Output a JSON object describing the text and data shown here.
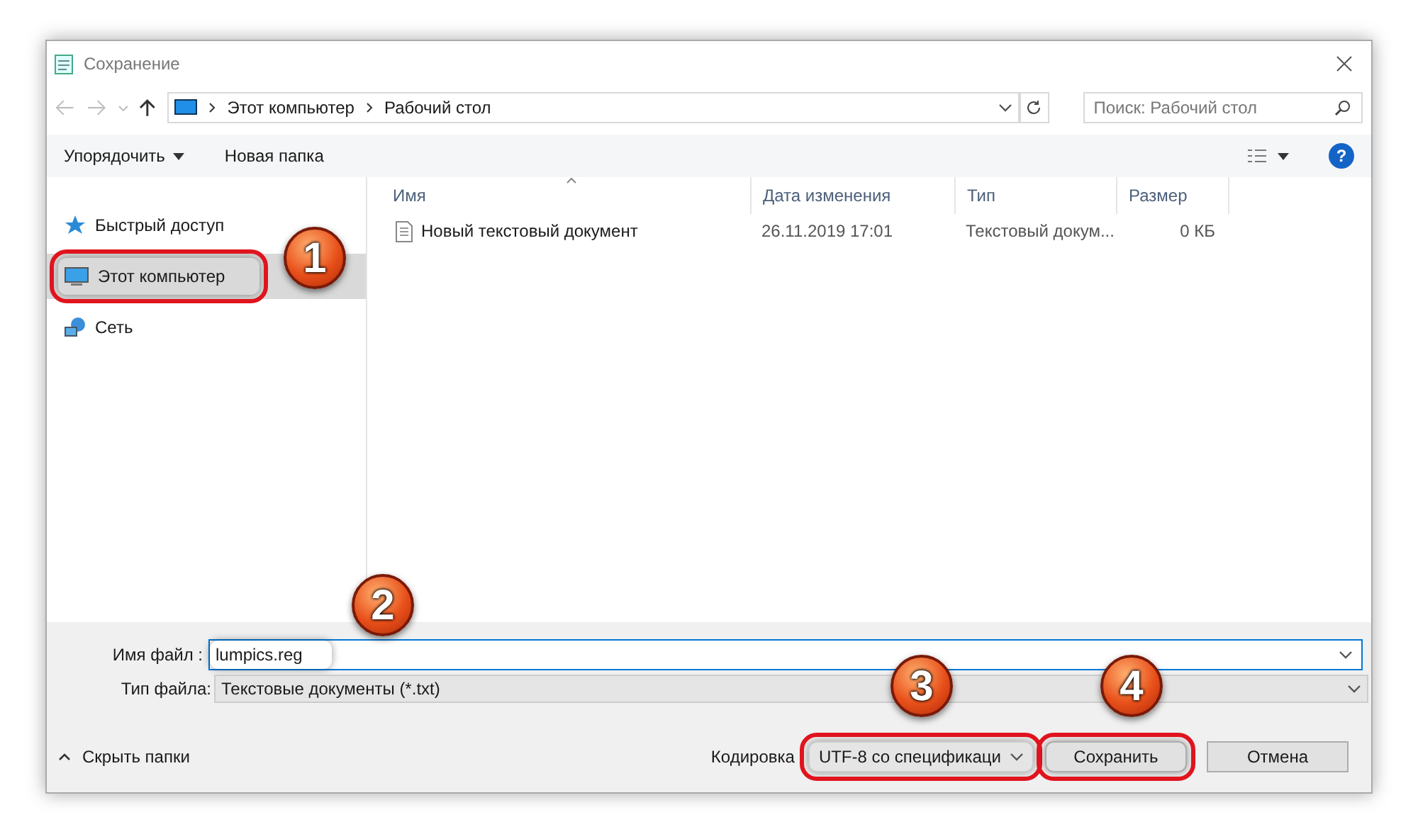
{
  "window": {
    "title": "Сохранение"
  },
  "address": {
    "crumbs": [
      "Этот компьютер",
      "Рабочий стол"
    ]
  },
  "search": {
    "placeholder": "Поиск: Рабочий стол"
  },
  "toolbar": {
    "organize": "Упорядочить",
    "new_folder": "Новая папка",
    "help": "?"
  },
  "sidebar": {
    "items": [
      {
        "label": "Быстрый доступ",
        "kind": "star",
        "selected": false,
        "highlighted": false
      },
      {
        "label": "Этот компьютер",
        "kind": "computer",
        "selected": true,
        "highlighted": true
      },
      {
        "label": "Сеть",
        "kind": "network",
        "selected": false,
        "highlighted": false
      }
    ]
  },
  "table": {
    "columns": [
      "Имя",
      "Дата изменения",
      "Тип",
      "Размер"
    ],
    "rows": [
      {
        "name": "Новый текстовый документ",
        "date": "26.11.2019 17:01",
        "type": "Текстовый докум...",
        "size": "0 КБ"
      }
    ]
  },
  "filename": {
    "label": "Имя файл :",
    "value": "lumpics.reg",
    "highlighted": true
  },
  "filetype": {
    "label": "Тип файла:",
    "value": "Текстовые документы (*.txt)"
  },
  "hide_folders": "Скрыть папки",
  "encoding": {
    "label": "Кодировка",
    "value": "UTF-8 со спецификаци",
    "highlighted": true
  },
  "buttons": [
    {
      "label": "Сохранить",
      "highlighted": true
    },
    {
      "label": "Отмена",
      "highlighted": false
    }
  ],
  "callouts": [
    "1",
    "2",
    "3",
    "4"
  ]
}
